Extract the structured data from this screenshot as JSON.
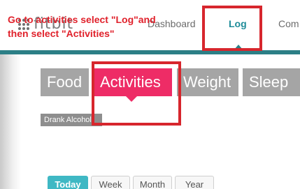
{
  "nav": {
    "logo_text": "fitbit",
    "items": [
      {
        "label": "Dashboard"
      },
      {
        "label": "Log"
      },
      {
        "label": "Com"
      }
    ]
  },
  "categories": [
    {
      "label": "Food"
    },
    {
      "label": "Activities",
      "active": true
    },
    {
      "label": "Weight"
    },
    {
      "label": "Sleep"
    }
  ],
  "badge": {
    "label": "Drank Alcohol"
  },
  "date_range": [
    {
      "label": "Today",
      "active": true
    },
    {
      "label": "Week"
    },
    {
      "label": "Month"
    },
    {
      "label": "Year"
    }
  ],
  "annotation": {
    "line1": "Go to activities select \"Log\"and",
    "line2": "then select \"Activities\""
  },
  "colors": {
    "accent_pink": "#ee2c66",
    "accent_teal": "#3fb8c4",
    "nav_teal": "#2c7f86",
    "annotation_red": "#d7262d"
  }
}
